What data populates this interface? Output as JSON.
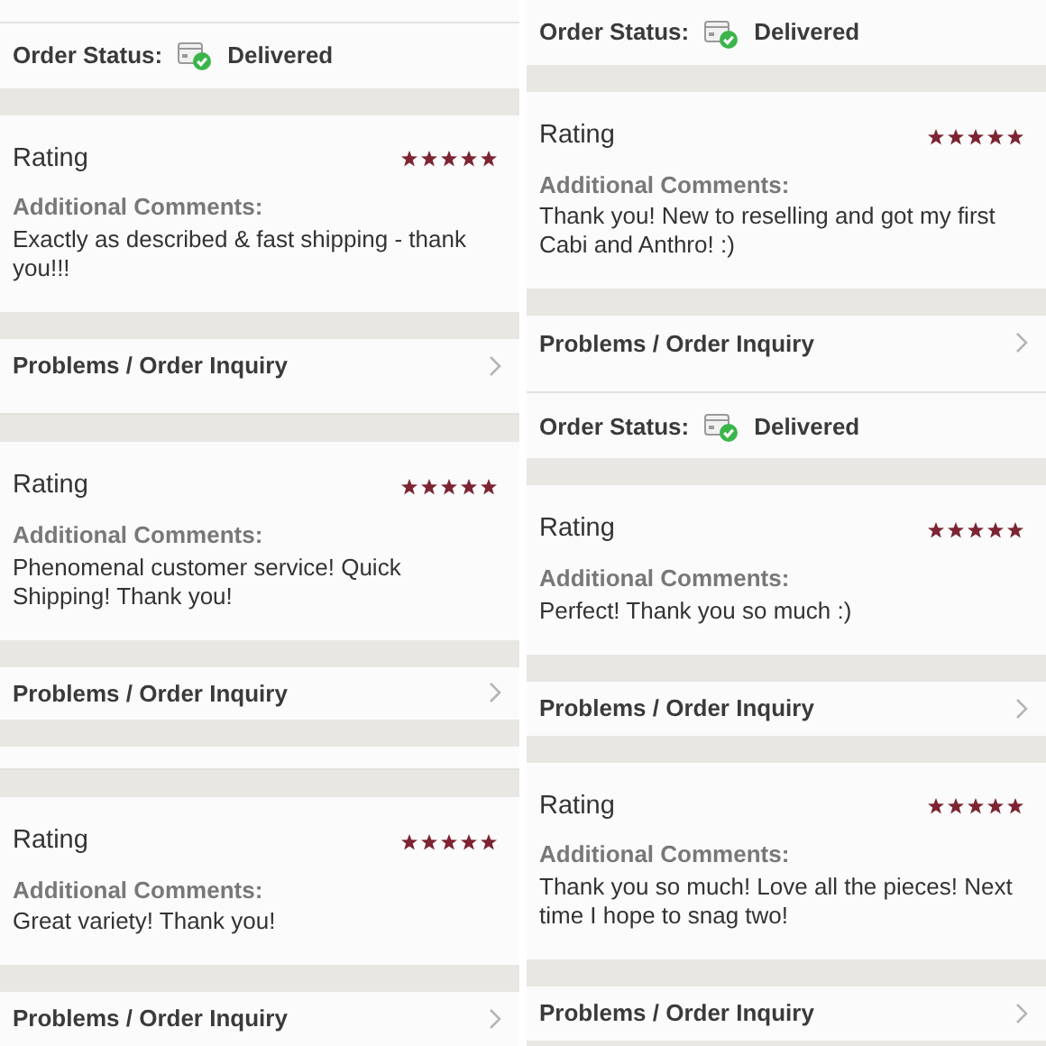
{
  "columns": [
    {
      "segments": [
        {
          "kind": "blank"
        },
        {
          "kind": "status",
          "label": "Order Status:",
          "value": "Delivered"
        },
        {
          "kind": "gap"
        },
        {
          "kind": "rating",
          "title": "Rating",
          "stars": 5,
          "comment_label": "Additional Comments:",
          "comment": "Exactly as described & fast shipping - thank you!!!"
        },
        {
          "kind": "gap"
        },
        {
          "kind": "problems",
          "label": "Problems / Order Inquiry"
        },
        {
          "kind": "blank"
        },
        {
          "kind": "gap"
        },
        {
          "kind": "rating",
          "title": "Rating",
          "stars": 5,
          "comment_label": "Additional Comments:",
          "comment": "Phenomenal customer service! Quick Shipping! Thank you!"
        },
        {
          "kind": "gap"
        },
        {
          "kind": "problems",
          "label": "Problems / Order Inquiry"
        },
        {
          "kind": "gap"
        },
        {
          "kind": "blank"
        },
        {
          "kind": "gap"
        },
        {
          "kind": "rating",
          "title": "Rating",
          "stars": 5,
          "comment_label": "Additional Comments:",
          "comment": "Great variety! Thank you!"
        },
        {
          "kind": "gap"
        },
        {
          "kind": "problems",
          "label": "Problems / Order Inquiry"
        }
      ]
    },
    {
      "segments": [
        {
          "kind": "status",
          "label": "Order Status:",
          "value": "Delivered"
        },
        {
          "kind": "gap"
        },
        {
          "kind": "rating",
          "title": "Rating",
          "stars": 5,
          "comment_label": "Additional Comments:",
          "comment": "Thank you! New to reselling and got my first Cabi and Anthro! :)"
        },
        {
          "kind": "gap"
        },
        {
          "kind": "problems",
          "label": "Problems / Order Inquiry"
        },
        {
          "kind": "blank"
        },
        {
          "kind": "status",
          "label": "Order Status:",
          "value": "Delivered"
        },
        {
          "kind": "gap"
        },
        {
          "kind": "rating",
          "title": "Rating",
          "stars": 5,
          "comment_label": "Additional Comments:",
          "comment": "Perfect! Thank you so much :)"
        },
        {
          "kind": "gap"
        },
        {
          "kind": "problems",
          "label": "Problems / Order Inquiry"
        },
        {
          "kind": "gap"
        },
        {
          "kind": "rating",
          "title": "Rating",
          "stars": 5,
          "comment_label": "Additional Comments:",
          "comment": "Thank you so much! Love all the pieces! Next time I hope to snag two!"
        },
        {
          "kind": "gap"
        },
        {
          "kind": "problems",
          "label": "Problems / Order Inquiry"
        }
      ]
    }
  ]
}
